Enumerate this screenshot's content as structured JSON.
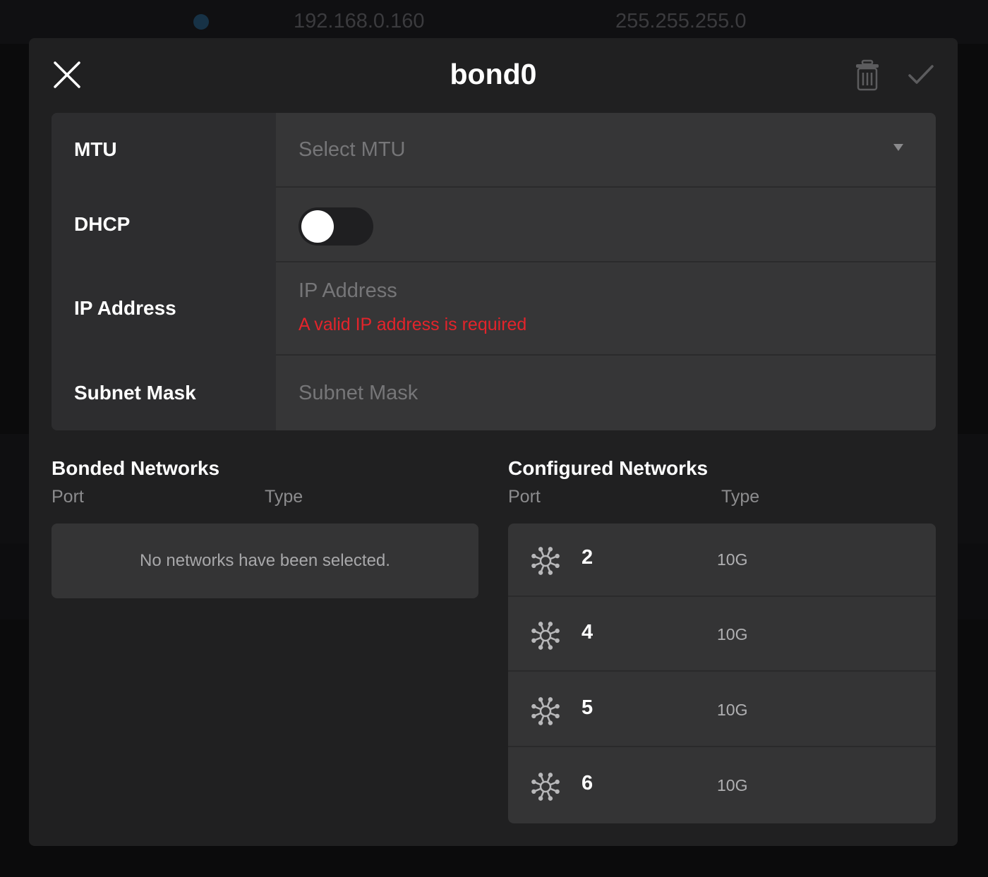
{
  "background": {
    "ip": "192.168.0.160",
    "mask": "255.255.255.0"
  },
  "dialog": {
    "title": "bond0",
    "close_icon": "close-icon",
    "delete_icon": "trash-icon",
    "confirm_icon": "check-icon"
  },
  "form": {
    "mtu": {
      "label": "MTU",
      "placeholder": "Select MTU"
    },
    "dhcp": {
      "label": "DHCP",
      "enabled": false
    },
    "ip_address": {
      "label": "IP Address",
      "placeholder": "IP Address",
      "error": "A valid IP address is required"
    },
    "subnet_mask": {
      "label": "Subnet Mask",
      "placeholder": "Subnet Mask"
    }
  },
  "bonded": {
    "title": "Bonded Networks",
    "col_port": "Port",
    "col_type": "Type",
    "empty_message": "No networks have been selected."
  },
  "configured": {
    "title": "Configured Networks",
    "col_port": "Port",
    "col_type": "Type",
    "rows": [
      {
        "port": "2",
        "type": "10G",
        "icon": "network-hub-icon"
      },
      {
        "port": "4",
        "type": "10G",
        "icon": "network-hub-icon"
      },
      {
        "port": "5",
        "type": "10G",
        "icon": "network-hub-icon"
      },
      {
        "port": "6",
        "type": "10G",
        "icon": "network-hub-icon"
      }
    ]
  },
  "colors": {
    "error": "#e3242b",
    "modal_bg": "#202021",
    "field_bg": "#363637"
  }
}
